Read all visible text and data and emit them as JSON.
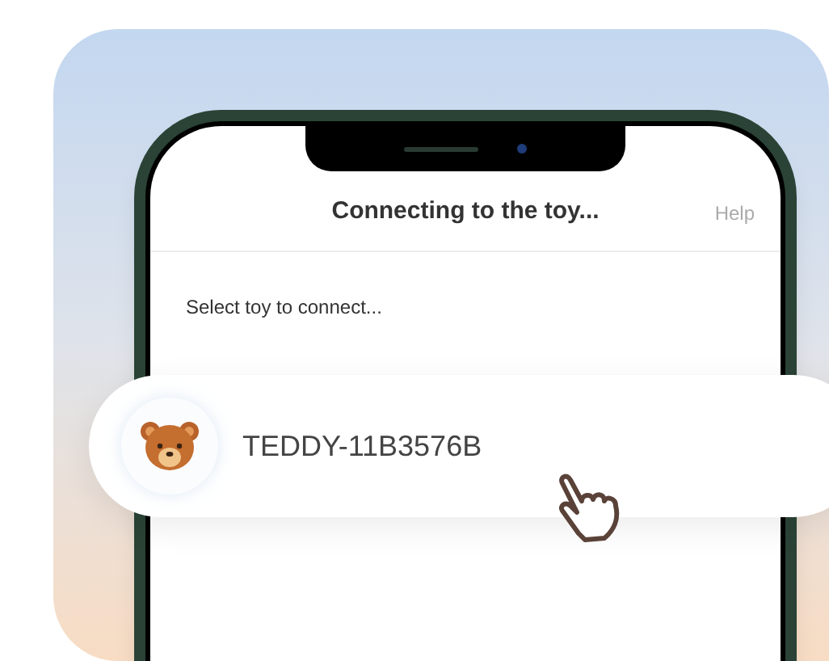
{
  "header": {
    "title": "Connecting to the toy...",
    "help": "Help"
  },
  "prompt": "Select toy to connect...",
  "toys": [
    {
      "name": "TEDDY-11B3576B"
    }
  ]
}
